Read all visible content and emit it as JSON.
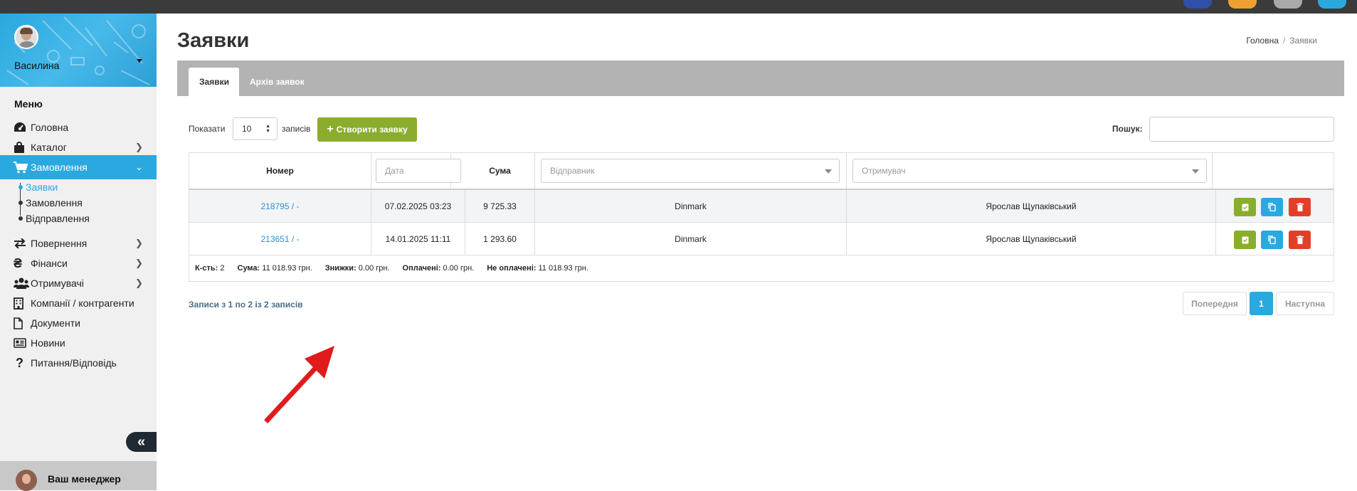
{
  "sidebar": {
    "username": "Василина",
    "menu_title": "Меню",
    "items": [
      {
        "label": "Головна",
        "icon": "dashboard-icon"
      },
      {
        "label": "Каталог",
        "icon": "shopping-bag-icon"
      },
      {
        "label": "Замовлення",
        "icon": "cart-icon"
      },
      {
        "label": "Повернення",
        "icon": "exchange-icon"
      },
      {
        "label": "Фінанси",
        "icon": "hryvnia-icon"
      },
      {
        "label": "Отримувачі",
        "icon": "users-icon"
      },
      {
        "label": "Компанії / контрагенти",
        "icon": "building-icon"
      },
      {
        "label": "Документи",
        "icon": "file-icon"
      },
      {
        "label": "Новини",
        "icon": "newspaper-icon"
      },
      {
        "label": "Питання/Відповідь",
        "icon": "question-icon"
      }
    ],
    "subitems": [
      "Заявки",
      "Замовлення",
      "Відправлення"
    ],
    "manager_label": "Ваш менеджер"
  },
  "page": {
    "title": "Заявки",
    "breadcrumb": {
      "home": "Головна",
      "separator": "/",
      "current": "Заявки"
    }
  },
  "tabs": [
    "Заявки",
    "Архів заявок"
  ],
  "controls": {
    "show_label": "Показати",
    "page_size": "10",
    "records_label": "записів",
    "create_button": "Створити заявку",
    "search_label": "Пошук:"
  },
  "table": {
    "headers": {
      "number": "Номер",
      "sum": "Сума"
    },
    "filters": {
      "date": "Дата",
      "sender": "Відправник",
      "recipient": "Отримувач"
    },
    "rows": [
      {
        "number": "218795 / -",
        "date": "07.02.2025 03:23",
        "sum": "9 725.33",
        "sender": "Dinmark",
        "recipient": "Ярослав Щупаківський"
      },
      {
        "number": "213651 / -",
        "date": "14.01.2025 11:11",
        "sum": "1 293.60",
        "sender": "Dinmark",
        "recipient": "Ярослав Щупаківський"
      }
    ],
    "totals": {
      "count_label": "К-сть:",
      "count": "2",
      "sum_label": "Сума:",
      "sum": "11 018.93 грн.",
      "discount_label": "Знижки:",
      "discount": "0.00 грн.",
      "paid_label": "Оплачені:",
      "paid": "0.00 грн.",
      "unpaid_label": "Не оплачені:",
      "unpaid": "11 018.93 грн."
    }
  },
  "pagination": {
    "info": "Записи з 1 по 2 із 2 записів",
    "prev": "Попередня",
    "current": "1",
    "next": "Наступна"
  },
  "colors": {
    "accent": "#29a9e0",
    "green": "#8aad2d",
    "red": "#e0402a",
    "annotation_arrow": "#e01b1b"
  }
}
